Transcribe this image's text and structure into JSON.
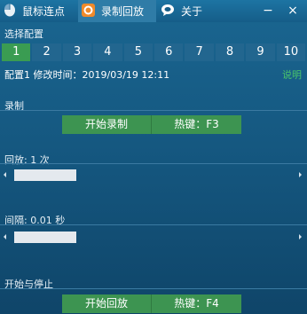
{
  "tabs": [
    {
      "label": "鼠标连点",
      "icon": "mouse-icon"
    },
    {
      "label": "录制回放",
      "icon": "record-icon",
      "active": true
    },
    {
      "label": "关于",
      "icon": "speech-bubble-icon"
    }
  ],
  "window": {
    "minimize": "−",
    "close": "×"
  },
  "config": {
    "section_label": "选择配置",
    "numbers": [
      "1",
      "2",
      "3",
      "4",
      "5",
      "6",
      "7",
      "8",
      "9",
      "10"
    ],
    "selected_index": 0,
    "info": "配置1  修改时间：2019/03/19 12:11",
    "help": "说明"
  },
  "record": {
    "section_label": "录制",
    "button": "开始录制",
    "hotkey": "热键：F3"
  },
  "playback": {
    "label": "回放: 1 次",
    "slider_value": 0.2
  },
  "interval": {
    "label": "间隔: 0.01 秒",
    "slider_value": 0.2
  },
  "start_stop": {
    "section_label": "开始与停止",
    "button": "开始回放",
    "hotkey": "热键：F4"
  },
  "colors": {
    "accent_green": "#3d9451",
    "background": "#14557d",
    "link_green": "#49c46a"
  }
}
